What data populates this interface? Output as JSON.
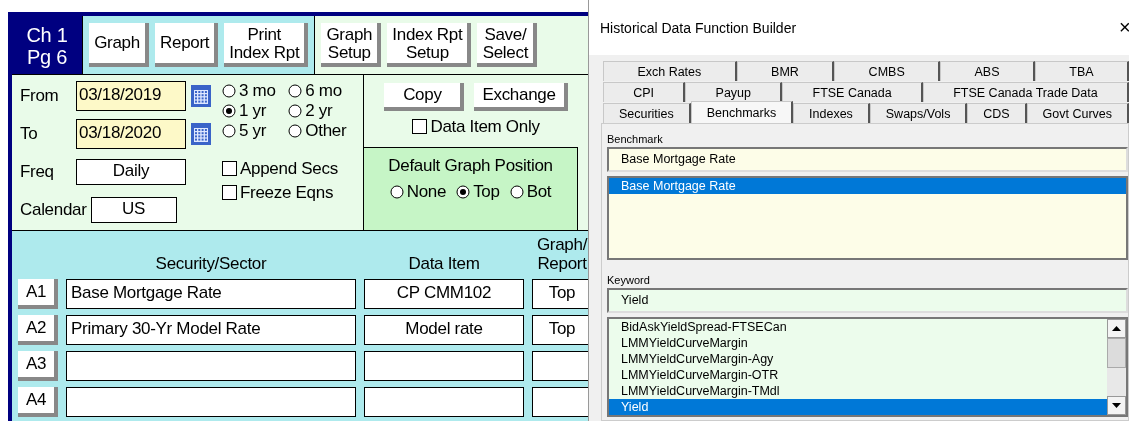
{
  "left_panel": {
    "chapter": "Ch 1",
    "page": "Pg 6",
    "primary_buttons": [
      "Graph",
      "Report",
      "Print\nIndex Rpt"
    ],
    "setup_buttons": [
      "Graph\nSetup",
      "Index Rpt\nSetup",
      "Save/\nSelect"
    ],
    "from": {
      "label": "From",
      "value": "03/18/2019"
    },
    "to": {
      "label": "To",
      "value": "03/18/2020"
    },
    "freq": {
      "label": "Freq",
      "value": "Daily"
    },
    "calendar": {
      "label": "Calendar",
      "value": "US"
    },
    "periods": [
      {
        "label": "3 mo",
        "selected": false
      },
      {
        "label": "6 mo",
        "selected": false
      },
      {
        "label": "1 yr",
        "selected": true
      },
      {
        "label": "2 yr",
        "selected": false
      },
      {
        "label": "5 yr",
        "selected": false
      },
      {
        "label": "Other",
        "selected": false
      }
    ],
    "options": [
      {
        "label": "Append Secs",
        "checked": false
      },
      {
        "label": "Freeze Eqns",
        "checked": false
      }
    ],
    "actions": [
      "Copy",
      "Exchange"
    ],
    "data_item_only": {
      "label": "Data Item Only",
      "checked": false
    },
    "graph_position": {
      "title": "Default Graph Position",
      "options": [
        {
          "label": "None",
          "selected": false
        },
        {
          "label": "Top",
          "selected": true
        },
        {
          "label": "Bot",
          "selected": false
        }
      ]
    },
    "table": {
      "columns": [
        "Security/Sector",
        "Data Item",
        "Graph/\nReport"
      ],
      "rows": [
        {
          "label": "A1",
          "security": "Base Mortgage Rate",
          "data_item": "CP CMM102",
          "position": "Top"
        },
        {
          "label": "A2",
          "security": "Primary 30-Yr Model Rate",
          "data_item": "Model rate",
          "position": "Top"
        },
        {
          "label": "A3"
        },
        {
          "label": "A4"
        }
      ]
    }
  },
  "dialog": {
    "title": "Historical Data Function Builder",
    "close": "×",
    "tab_rows": [
      [
        {
          "label": "Exch Rates",
          "selected": false
        },
        {
          "label": "BMR",
          "selected": false
        },
        {
          "label": "CMBS",
          "selected": false
        },
        {
          "label": "ABS",
          "selected": false
        },
        {
          "label": "TBA",
          "selected": false
        }
      ],
      [
        {
          "label": "CPI",
          "selected": false
        },
        {
          "label": "Payup",
          "selected": false
        },
        {
          "label": "FTSE Canada",
          "selected": false
        },
        {
          "label": "FTSE Canada Trade Data",
          "selected": false
        }
      ],
      [
        {
          "label": "Securities",
          "selected": false
        },
        {
          "label": "Benchmarks",
          "selected": true
        },
        {
          "label": "Indexes",
          "selected": false
        },
        {
          "label": "Swaps/Vols",
          "selected": false
        },
        {
          "label": "CDS",
          "selected": false
        },
        {
          "label": "Govt Curves",
          "selected": false
        }
      ]
    ],
    "benchmark": {
      "label": "Benchmark",
      "value": "Base Mortgage Rate",
      "items": [
        {
          "label": "Base Mortgage Rate",
          "selected": true
        }
      ]
    },
    "keyword": {
      "label": "Keyword",
      "value": "Yield",
      "items": [
        {
          "label": "BidAskYieldSpread-FTSECan",
          "selected": false
        },
        {
          "label": "LMMYieldCurveMargin",
          "selected": false
        },
        {
          "label": "LMMYieldCurveMargin-Agy",
          "selected": false
        },
        {
          "label": "LMMYieldCurveMargin-OTR",
          "selected": false
        },
        {
          "label": "LMMYieldCurveMargin-TMdl",
          "selected": false
        },
        {
          "label": "Yield",
          "selected": true
        }
      ]
    }
  }
}
